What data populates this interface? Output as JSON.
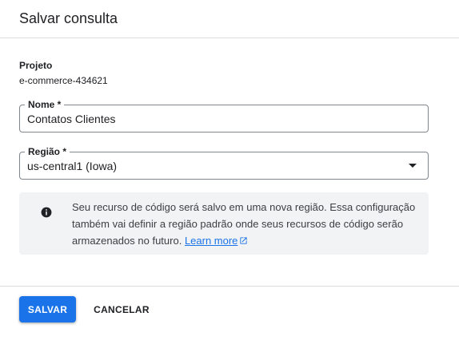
{
  "dialog": {
    "title": "Salvar consulta"
  },
  "project": {
    "label": "Projeto",
    "value": "e-commerce-434621"
  },
  "name_field": {
    "label": "Nome *",
    "value": "Contatos Clientes"
  },
  "region_field": {
    "label": "Região *",
    "selected": "us-central1 (Iowa)"
  },
  "info": {
    "icon": "info-icon",
    "text": "Seu recurso de código será salvo em uma nova região. Essa configuração também vai definir a região padrão onde seus recursos de código serão armazenados no futuro.",
    "link_text": "Learn more",
    "link_icon": "open-in-new-icon"
  },
  "actions": {
    "save_label": "SALVAR",
    "cancel_label": "CANCELAR"
  },
  "colors": {
    "primary": "#1a73e8",
    "info_background": "#f1f3f4",
    "border": "#80868b"
  }
}
